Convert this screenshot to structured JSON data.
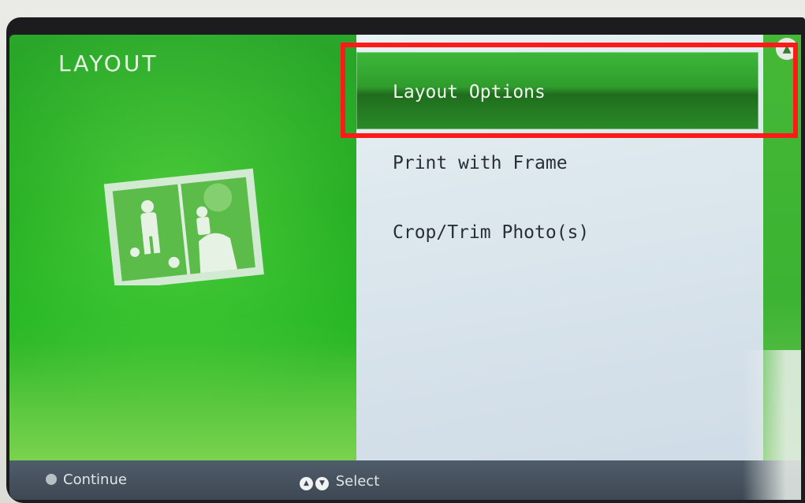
{
  "screen": {
    "title": "LAYOUT"
  },
  "menu": {
    "items": [
      {
        "label": "Layout Options",
        "selected": true
      },
      {
        "label": "Print with Frame",
        "selected": false
      },
      {
        "label": "Crop/Trim Photo(s)",
        "selected": false
      }
    ]
  },
  "footer": {
    "continue_label": "Continue",
    "select_label": "Select"
  },
  "icons": {
    "scroll_up": "chevron-up-icon",
    "continue": "ok-button-icon",
    "up": "up-arrow-icon",
    "down": "down-arrow-icon",
    "illustration": "photo-frame-illustration"
  },
  "colors": {
    "panel_green": "#1ea81e",
    "highlight": "#ff1a1a",
    "list_bg": "#dde8ee",
    "footer_bg": "#3d4853"
  }
}
